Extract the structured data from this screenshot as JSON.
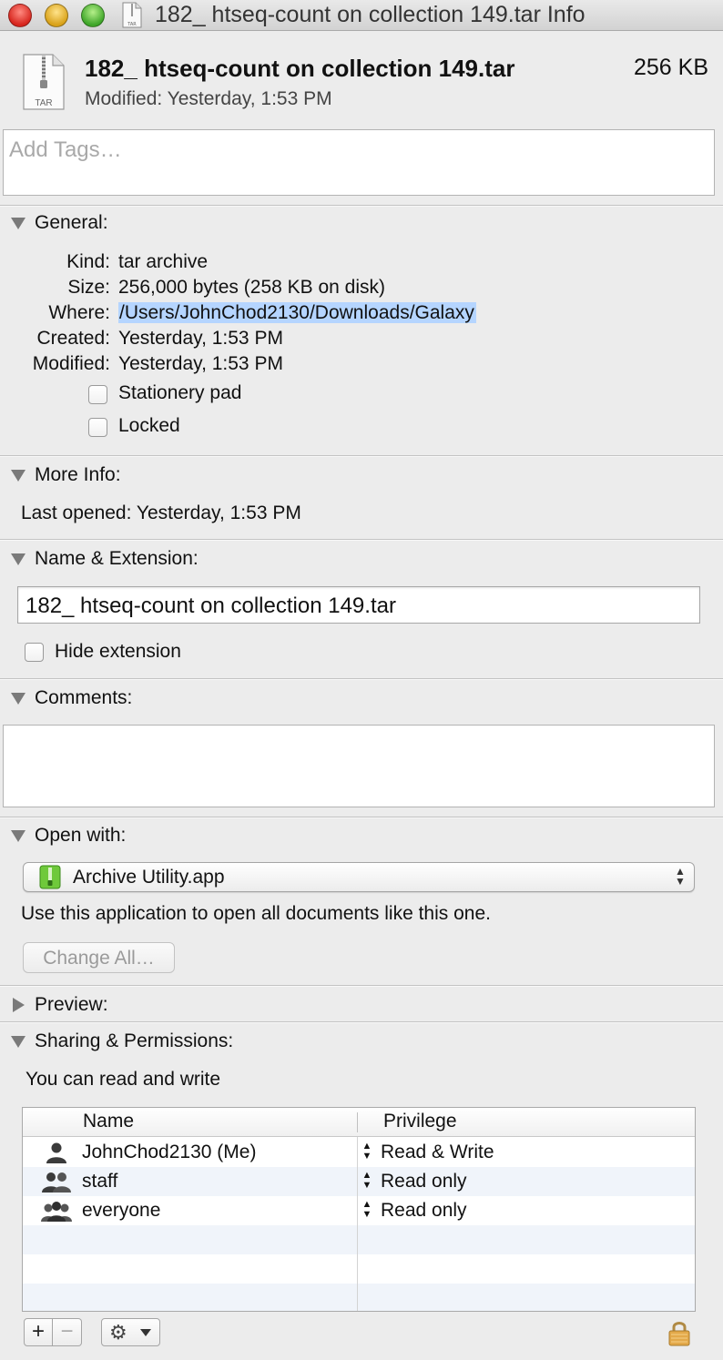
{
  "window": {
    "title": "182_ htseq-count on collection 149.tar Info"
  },
  "header": {
    "file_name": "182_ htseq-count on collection 149.tar",
    "file_size": "256 KB",
    "modified": "Modified: Yesterday, 1:53 PM",
    "icon_label": "TAR"
  },
  "tags": {
    "placeholder": "Add Tags…"
  },
  "general": {
    "title": "General:",
    "rows": [
      {
        "label": "Kind:",
        "value": "tar archive"
      },
      {
        "label": "Size:",
        "value": "256,000 bytes (258 KB on disk)"
      },
      {
        "label": "Where:",
        "value": "/Users/JohnChod2130/Downloads/Galaxy"
      },
      {
        "label": "Created:",
        "value": "Yesterday, 1:53 PM"
      },
      {
        "label": "Modified:",
        "value": "Yesterday, 1:53 PM"
      }
    ],
    "stationery_label": "Stationery pad",
    "locked_label": "Locked"
  },
  "more_info": {
    "title": "More Info:",
    "last_opened": "Last opened: Yesterday, 1:53 PM"
  },
  "name_extension": {
    "title": "Name & Extension:",
    "name_value": "182_ htseq-count on collection 149.tar",
    "hide_extension_label": "Hide extension"
  },
  "comments": {
    "title": "Comments:"
  },
  "open_with": {
    "title": "Open with:",
    "app": "Archive Utility.app",
    "description": "Use this application to open all documents like this one.",
    "change_all_label": "Change All…"
  },
  "preview": {
    "title": "Preview:"
  },
  "sharing": {
    "title": "Sharing & Permissions:",
    "note": "You can read and write",
    "columns": [
      "Name",
      "Privilege"
    ],
    "rows": [
      {
        "name": "JohnChod2130 (Me)",
        "privilege": "Read & Write",
        "icon": "single-user-icon"
      },
      {
        "name": "staff",
        "privilege": "Read only",
        "icon": "group-icon"
      },
      {
        "name": "everyone",
        "privilege": "Read only",
        "icon": "everyone-icon"
      }
    ]
  },
  "controls": {
    "add": "+",
    "remove": "−",
    "gear": "⚙"
  },
  "colors": {
    "selection_highlight": "#b5d5ff",
    "background": "#ececec"
  }
}
